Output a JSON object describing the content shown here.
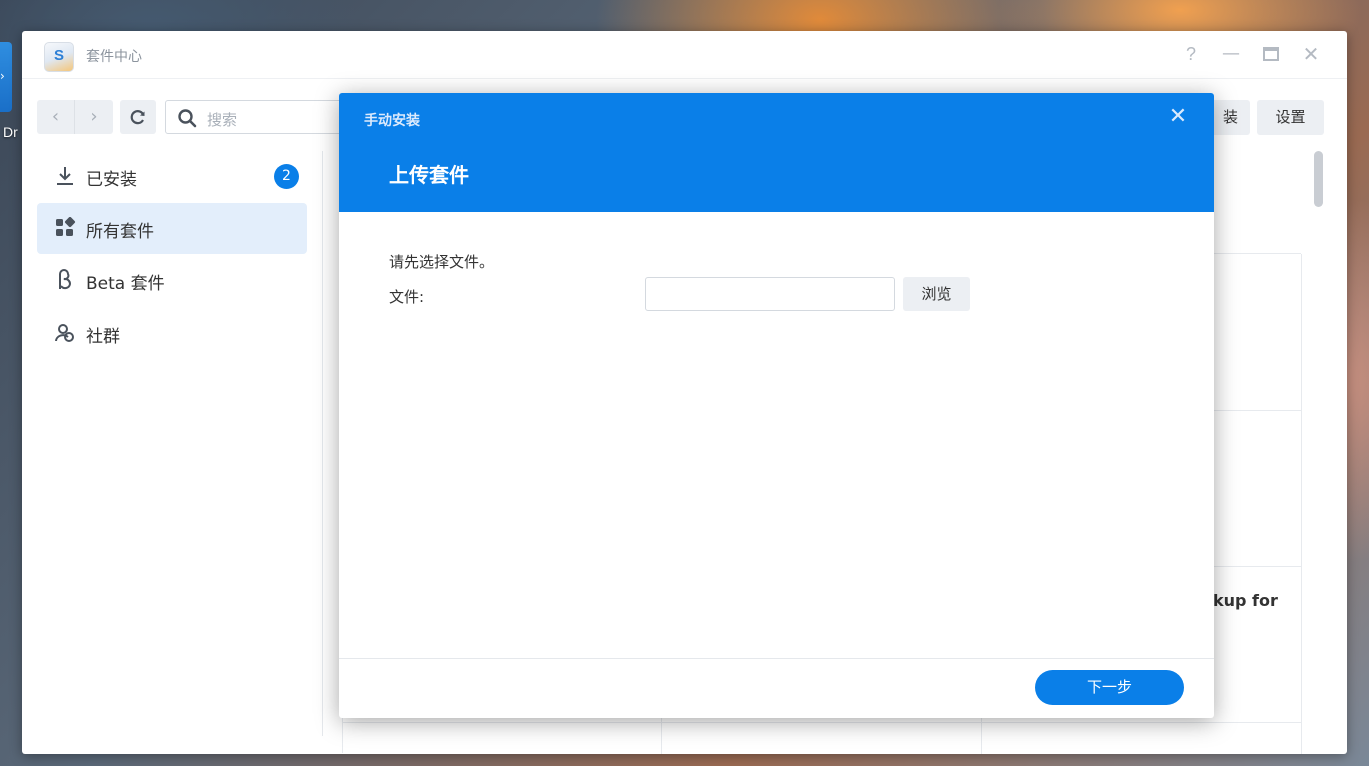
{
  "desktop": {
    "icon_label": "Dr"
  },
  "window": {
    "title": "套件中心",
    "app_icon_letter": "S",
    "controls": {
      "help": "?",
      "minimize": "—",
      "maximize": "□",
      "close": "✕"
    }
  },
  "toolbar": {
    "back": "‹",
    "forward": "›",
    "refresh": "↻",
    "search_placeholder": "搜索",
    "manual_install_label": "装",
    "settings_label": "设置"
  },
  "sidebar": {
    "items": [
      {
        "label": "已安装",
        "icon": "download-icon",
        "badge": "2",
        "active": false
      },
      {
        "label": "所有套件",
        "icon": "grid-icon",
        "active": true
      },
      {
        "label": "Beta 套件",
        "icon": "beta-icon",
        "active": false
      },
      {
        "label": "社群",
        "icon": "community-icon",
        "active": false
      }
    ]
  },
  "background_content": {
    "partial_card_title": "kup for"
  },
  "dialog": {
    "title": "手动安装",
    "close": "✕",
    "step_title": "上传套件",
    "instruction": "请先选择文件。",
    "file_label": "文件:",
    "file_value": "",
    "browse_label": "浏览",
    "next_label": "下一步"
  },
  "colors": {
    "accent": "#0a7fe8",
    "sidebar_active": "#e3eefb",
    "button_bg": "#eceff3"
  }
}
